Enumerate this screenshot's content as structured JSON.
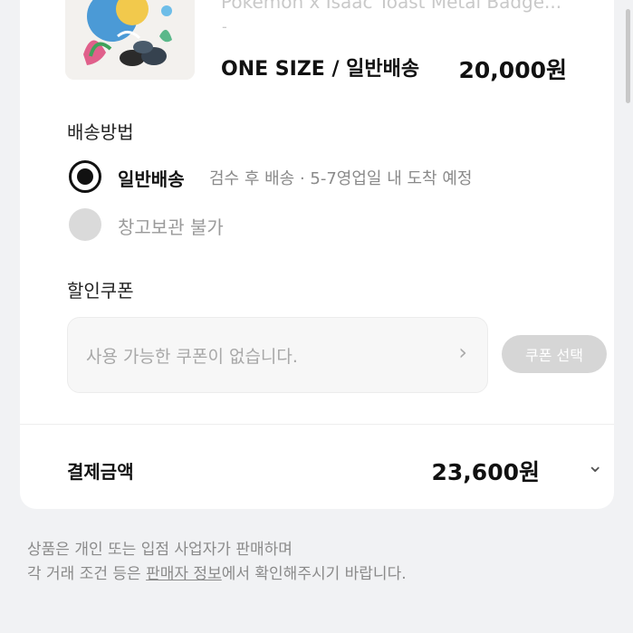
{
  "product": {
    "name": "Pokemon x Isaac Toast Metal Badge...",
    "dash": "-",
    "option": "ONE SIZE / 일반배송",
    "price": "20,000원"
  },
  "shipping": {
    "title": "배송방법",
    "options": [
      {
        "label": "일반배송",
        "detail": "검수 후 배송 · 5-7영업일 내 도착 예정",
        "selected": true
      },
      {
        "label": "창고보관 불가",
        "selected": false
      }
    ]
  },
  "coupon": {
    "title": "할인쿠폰",
    "placeholder": "사용 가능한 쿠폰이 없습니다.",
    "button_label": "쿠폰 선택"
  },
  "payment": {
    "label": "결제금액",
    "value": "23,600원"
  },
  "footer": {
    "line1": "상품은 개인 또는 입점 사업자가 판매하며",
    "line2_prefix": "각 거래 조건 등은 ",
    "line2_link": "판매자 정보",
    "line2_suffix": "에서 확인해주시기 바랍니다."
  },
  "icons": {
    "coupon_chevron": "chevron-right-icon",
    "total_chevron": "chevron-down-icon"
  },
  "colors": {
    "background": "#f1f2f4",
    "card": "#ffffff",
    "selected_radio": "#111111",
    "disabled": "#d6d6d6"
  }
}
